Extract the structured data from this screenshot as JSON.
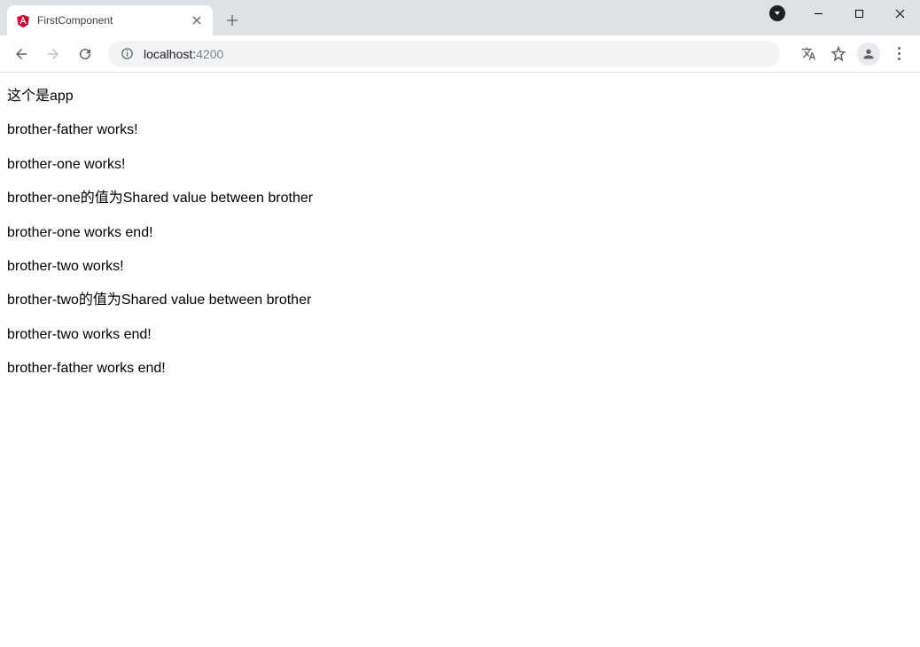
{
  "tab": {
    "title": "FirstComponent"
  },
  "address": {
    "host": "localhost:",
    "port": "4200"
  },
  "content": {
    "lines": [
      "这个是app",
      "brother-father works!",
      "brother-one works!",
      "brother-one的值为Shared value between brother",
      "brother-one works end!",
      "brother-two works!",
      "brother-two的值为Shared value between brother",
      "brother-two works end!",
      "brother-father works end!"
    ]
  }
}
